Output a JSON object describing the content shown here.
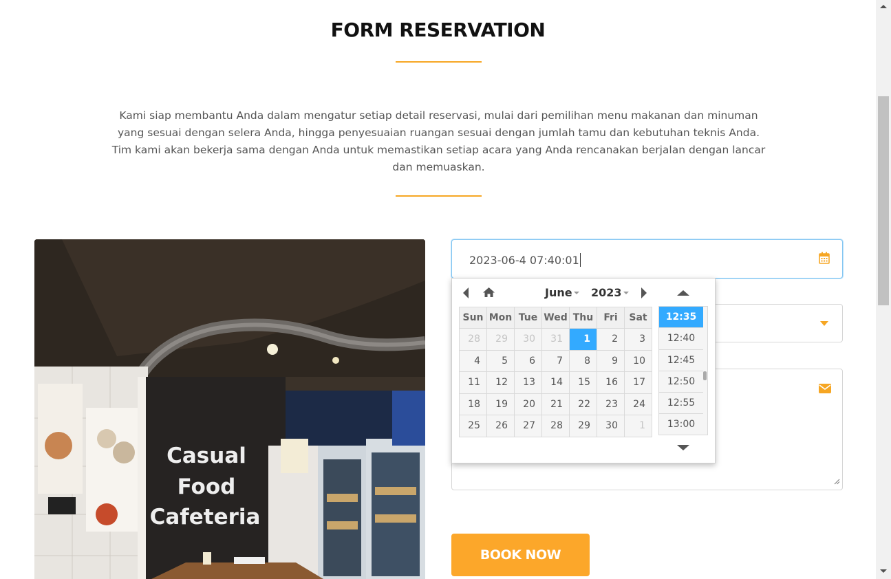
{
  "section": {
    "title": "FORM RESERVATION",
    "intro_lines": [
      "Kami siap membantu Anda dalam mengatur setiap detail reservasi, mulai dari pemilihan menu makanan dan minuman",
      "yang sesuai dengan selera Anda, hingga penyesuaian ruangan sesuai dengan jumlah tamu dan kebutuhan teknis Anda.",
      "Tim kami akan bekerja sama dengan Anda untuk memastikan setiap acara yang Anda rencanakan berjalan dengan lancar",
      "dan memuaskan."
    ],
    "accent_color": "#f6a623"
  },
  "photo": {
    "sign_lines": [
      "Casual",
      "Food",
      "Cafeteria"
    ]
  },
  "form": {
    "datetime_value": "2023-06-4 07:40:01",
    "calendar_icon": "calendar-icon",
    "select_icon": "chevron-down-icon",
    "message_icon": "envelope-icon",
    "book_label": "BOOK NOW",
    "button_color": "#fca72a"
  },
  "picker": {
    "month": "June",
    "year": "2023",
    "weekdays": [
      "Sun",
      "Mon",
      "Tue",
      "Wed",
      "Thu",
      "Fri",
      "Sat"
    ],
    "weeks": [
      [
        {
          "d": "28",
          "o": true
        },
        {
          "d": "29",
          "o": true
        },
        {
          "d": "30",
          "o": true
        },
        {
          "d": "31",
          "o": true
        },
        {
          "d": "1",
          "c": true
        },
        {
          "d": "2"
        },
        {
          "d": "3"
        }
      ],
      [
        {
          "d": "4"
        },
        {
          "d": "5"
        },
        {
          "d": "6"
        },
        {
          "d": "7"
        },
        {
          "d": "8"
        },
        {
          "d": "9"
        },
        {
          "d": "10"
        }
      ],
      [
        {
          "d": "11"
        },
        {
          "d": "12"
        },
        {
          "d": "13"
        },
        {
          "d": "14"
        },
        {
          "d": "15"
        },
        {
          "d": "16"
        },
        {
          "d": "17"
        }
      ],
      [
        {
          "d": "18"
        },
        {
          "d": "19"
        },
        {
          "d": "20"
        },
        {
          "d": "21"
        },
        {
          "d": "22"
        },
        {
          "d": "23"
        },
        {
          "d": "24"
        }
      ],
      [
        {
          "d": "25"
        },
        {
          "d": "26"
        },
        {
          "d": "27"
        },
        {
          "d": "28"
        },
        {
          "d": "29"
        },
        {
          "d": "30"
        },
        {
          "d": "1",
          "o": true
        }
      ]
    ],
    "times": [
      "12:35",
      "12:40",
      "12:45",
      "12:50",
      "12:55",
      "13:00"
    ],
    "current_time": "12:35",
    "highlight_color": "#33aaff"
  }
}
